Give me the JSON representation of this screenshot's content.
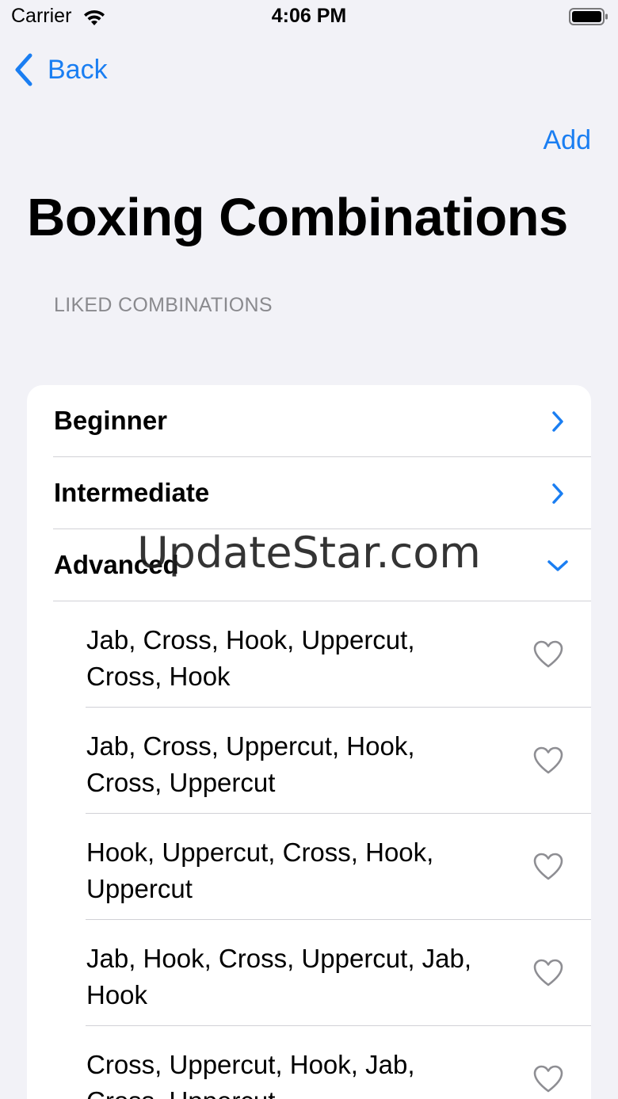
{
  "status_bar": {
    "carrier": "Carrier",
    "time": "4:06 PM"
  },
  "nav": {
    "back_label": "Back",
    "add_label": "Add"
  },
  "title": "Boxing Combinations",
  "section_header": "LIKED COMBINATIONS",
  "levels": [
    {
      "label": "Beginner",
      "state": "collapsed"
    },
    {
      "label": "Intermediate",
      "state": "collapsed"
    },
    {
      "label": "Advanced",
      "state": "expanded"
    }
  ],
  "combinations": [
    {
      "text": "Jab, Cross, Hook, Uppercut, Cross, Hook",
      "liked": false
    },
    {
      "text": "Jab, Cross, Uppercut, Hook, Cross, Uppercut",
      "liked": false
    },
    {
      "text": "Hook, Uppercut, Cross, Hook, Uppercut",
      "liked": false
    },
    {
      "text": "Jab, Hook, Cross, Uppercut, Jab, Hook",
      "liked": false
    },
    {
      "text": "Cross, Uppercut, Hook, Jab, Cross, Uppercut",
      "liked": false
    }
  ],
  "watermark": "UpdateStar.com",
  "colors": {
    "accent": "#1a7ef2",
    "background": "#f2f2f7",
    "card": "#ffffff",
    "separator": "#d1d1d6",
    "secondary_text": "#8a8a8e",
    "heart_outline": "#8e8e93"
  },
  "icons": [
    "wifi-icon",
    "battery-icon",
    "back-chevron-icon",
    "chevron-right-icon",
    "chevron-down-icon",
    "heart-outline-icon"
  ]
}
